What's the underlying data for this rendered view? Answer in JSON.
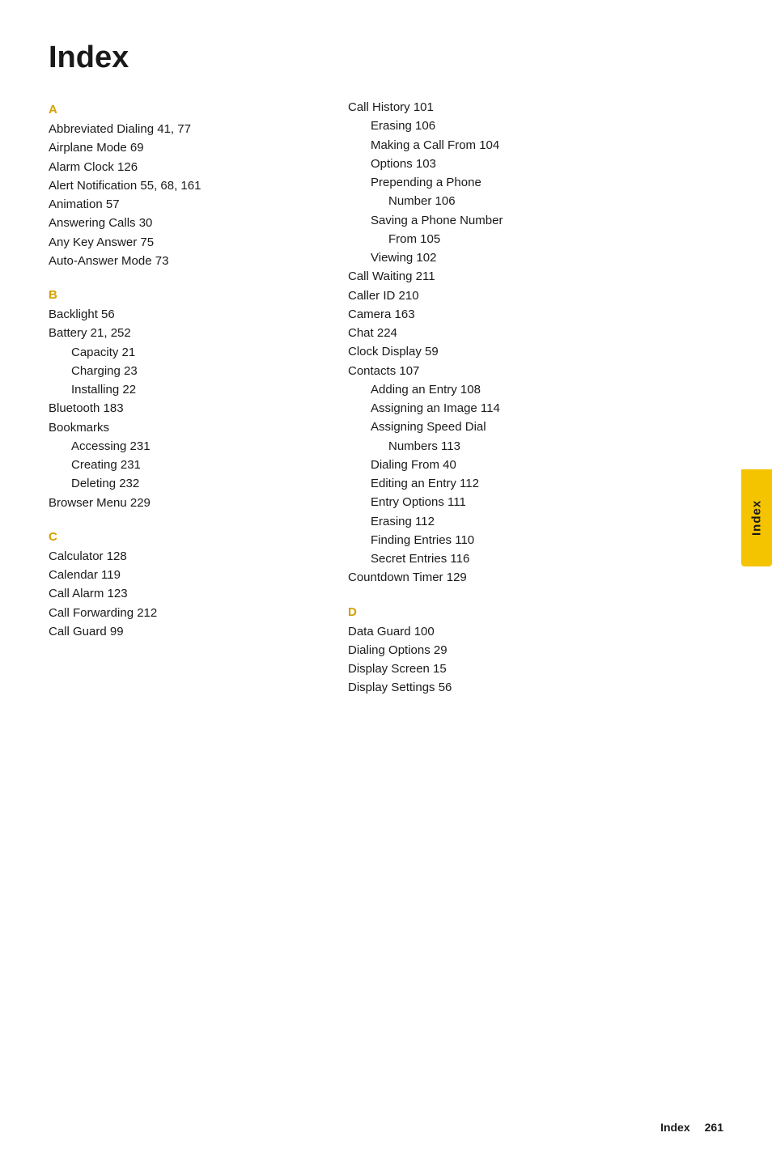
{
  "page": {
    "title": "Index",
    "footer": {
      "label": "Index",
      "page_number": "261"
    }
  },
  "side_tab": {
    "label": "Index"
  },
  "left_column": {
    "sections": [
      {
        "letter": "A",
        "entries": [
          {
            "text": "Abbreviated Dialing 41, 77",
            "indent": 0
          },
          {
            "text": "Airplane Mode 69",
            "indent": 0
          },
          {
            "text": "Alarm Clock 126",
            "indent": 0
          },
          {
            "text": "Alert Notification  55, 68, 161",
            "indent": 0
          },
          {
            "text": "Animation 57",
            "indent": 0
          },
          {
            "text": "Answering Calls  30",
            "indent": 0
          },
          {
            "text": "Any Key Answer 75",
            "indent": 0
          },
          {
            "text": "Auto-Answer Mode 73",
            "indent": 0
          }
        ]
      },
      {
        "letter": "B",
        "entries": [
          {
            "text": "Backlight 56",
            "indent": 0
          },
          {
            "text": "Battery 21, 252",
            "indent": 0
          },
          {
            "text": "Capacity 21",
            "indent": 1
          },
          {
            "text": "Charging 23",
            "indent": 1
          },
          {
            "text": "Installing 22",
            "indent": 1
          },
          {
            "text": "Bluetooth 183",
            "indent": 0
          },
          {
            "text": "Bookmarks",
            "indent": 0
          },
          {
            "text": "Accessing 231",
            "indent": 1
          },
          {
            "text": "Creating 231",
            "indent": 1
          },
          {
            "text": "Deleting 232",
            "indent": 1
          },
          {
            "text": "Browser Menu 229",
            "indent": 0
          }
        ]
      },
      {
        "letter": "C",
        "entries": [
          {
            "text": "Calculator 128",
            "indent": 0
          },
          {
            "text": "Calendar 119",
            "indent": 0
          },
          {
            "text": "Call Alarm 123",
            "indent": 0
          },
          {
            "text": "Call Forwarding 212",
            "indent": 0
          },
          {
            "text": "Call Guard 99",
            "indent": 0
          }
        ]
      }
    ]
  },
  "right_column": {
    "sections": [
      {
        "letter": null,
        "entries": [
          {
            "text": "Call History 101",
            "indent": 0
          },
          {
            "text": "Erasing 106",
            "indent": 1
          },
          {
            "text": "Making a Call From 104",
            "indent": 1
          },
          {
            "text": "Options 103",
            "indent": 1
          },
          {
            "text": "Prepending a Phone",
            "indent": 1
          },
          {
            "text": "Number 106",
            "indent": 2
          },
          {
            "text": "Saving a Phone Number",
            "indent": 1
          },
          {
            "text": "From 105",
            "indent": 2
          },
          {
            "text": "Viewing 102",
            "indent": 1
          },
          {
            "text": "Call Waiting 211",
            "indent": 0
          },
          {
            "text": "Caller ID 210",
            "indent": 0
          },
          {
            "text": "Camera 163",
            "indent": 0
          },
          {
            "text": "Chat 224",
            "indent": 0
          },
          {
            "text": "Clock Display 59",
            "indent": 0
          },
          {
            "text": "Contacts 107",
            "indent": 0
          },
          {
            "text": "Adding an Entry 108",
            "indent": 1
          },
          {
            "text": "Assigning an Image 114",
            "indent": 1
          },
          {
            "text": "Assigning Speed Dial",
            "indent": 1
          },
          {
            "text": "Numbers 113",
            "indent": 2
          },
          {
            "text": "Dialing From 40",
            "indent": 1
          },
          {
            "text": "Editing an Entry 112",
            "indent": 1
          },
          {
            "text": "Entry Options 111",
            "indent": 1
          },
          {
            "text": "Erasing 112",
            "indent": 1
          },
          {
            "text": "Finding Entries 110",
            "indent": 1
          },
          {
            "text": "Secret Entries 116",
            "indent": 1
          },
          {
            "text": "Countdown Timer 129",
            "indent": 0
          }
        ]
      },
      {
        "letter": "D",
        "entries": [
          {
            "text": "Data Guard 100",
            "indent": 0
          },
          {
            "text": "Dialing Options 29",
            "indent": 0
          },
          {
            "text": "Display Screen 15",
            "indent": 0
          },
          {
            "text": "Display Settings 56",
            "indent": 0
          }
        ]
      }
    ]
  }
}
